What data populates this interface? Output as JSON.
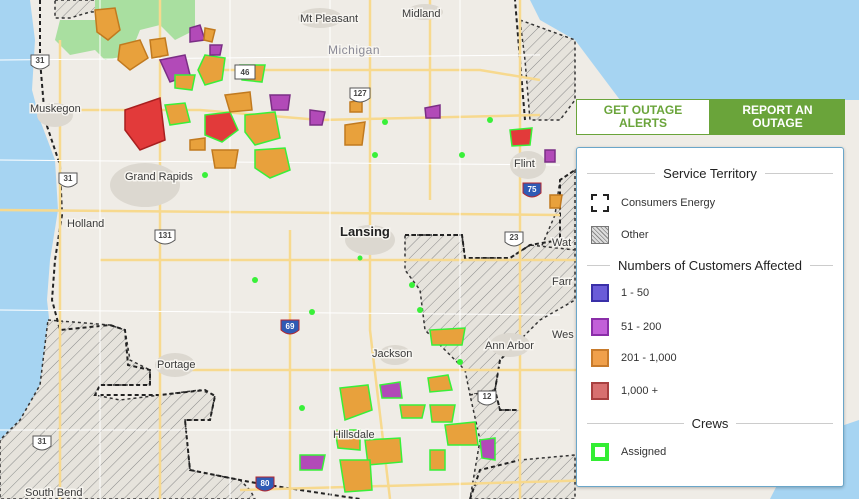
{
  "cities": [
    {
      "name": "Midland"
    },
    {
      "name": "Mt Pleasant"
    },
    {
      "name": "Muskegon"
    },
    {
      "name": "Grand Rapids"
    },
    {
      "name": "Holland"
    },
    {
      "name": "Lansing"
    },
    {
      "name": "Flint"
    },
    {
      "name": "Portage"
    },
    {
      "name": "Jackson"
    },
    {
      "name": "Ann Arbor"
    },
    {
      "name": "Hillsdale"
    },
    {
      "name": "South Bend"
    },
    {
      "name": "Wat"
    },
    {
      "name": "Farr"
    },
    {
      "name": "Wes"
    }
  ],
  "state_label": "Michigan",
  "highways": [
    "31",
    "31",
    "131",
    "46",
    "127",
    "69",
    "23",
    "12",
    "31",
    "80",
    "75"
  ],
  "buttons": {
    "alerts_label": "GET OUTAGE ALERTS",
    "report_label": "REPORT AN OUTAGE"
  },
  "legend": {
    "service_title": "Service Territory",
    "service_items": [
      {
        "label": "Consumers Energy"
      },
      {
        "label": "Other"
      }
    ],
    "customers_title": "Numbers of Customers Affected",
    "customer_items": [
      {
        "label": "1 - 50",
        "color": "#6a5cd8",
        "border": "#3a30a8"
      },
      {
        "label": "51 - 200",
        "color": "#c25fd8",
        "border": "#8a2ea8"
      },
      {
        "label": "201 - 1,000",
        "color": "#f0a04b",
        "border": "#c87b2b"
      },
      {
        "label": "1,000 +",
        "color": "#d87070",
        "border": "#a84040"
      }
    ],
    "crews_title": "Crews",
    "crew_items": [
      {
        "label": "Assigned",
        "color": "#33ee33"
      }
    ]
  },
  "colors": {
    "accent_green": "#6aa43a",
    "water": "#a6d4f2",
    "land": "#e8e6e1",
    "outage_small": "#7b5cd6",
    "outage_medium": "#b24ab8",
    "outage_large": "#e8a13c",
    "outage_xlarge": "#e23a3a",
    "crew": "#39f039"
  }
}
